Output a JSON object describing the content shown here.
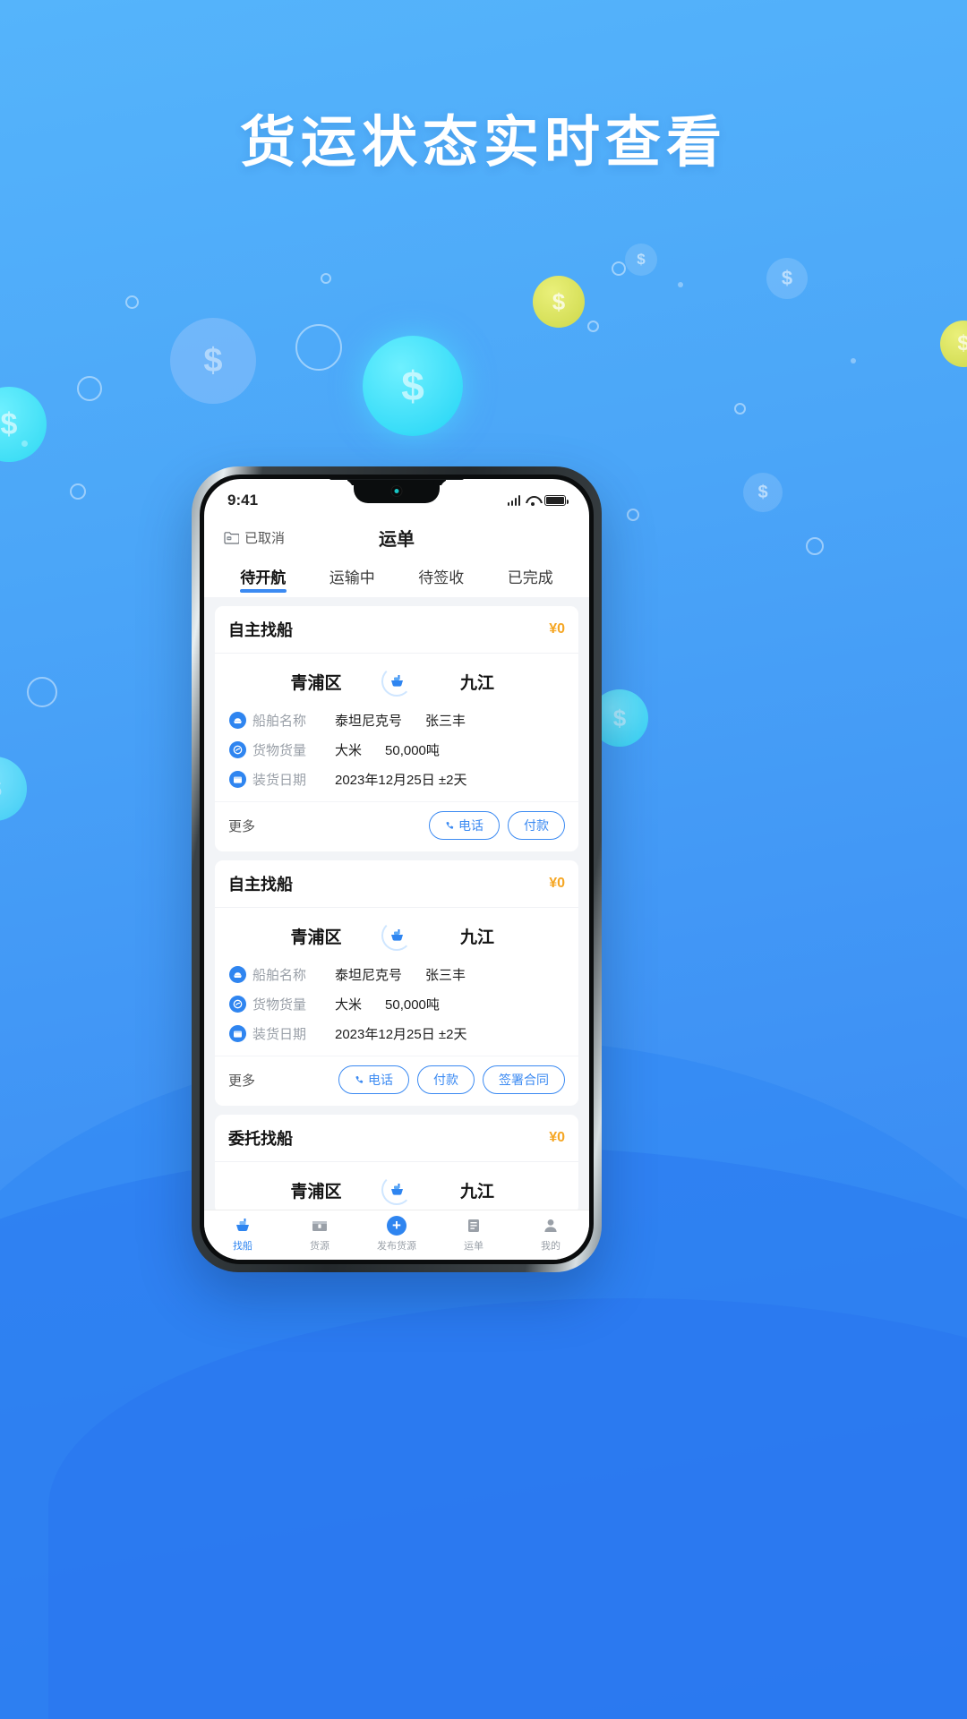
{
  "headline": "货运状态实时查看",
  "colors": {
    "brand_blue": "#3b8af2",
    "bg_top": "#55b4fb",
    "bg_bottom": "#2f7df2",
    "price_orange": "#f5a623",
    "muted": "#9aa0a8"
  },
  "phone": {
    "status_bar": {
      "time": "9:41",
      "signal_icon": "cellular-signal-icon",
      "wifi_icon": "wifi-icon",
      "battery_icon": "battery-icon"
    },
    "navbar": {
      "left_icon": "folder-cancel-icon",
      "left_label": "已取消",
      "title": "运单"
    },
    "tabs": [
      {
        "label": "待开航",
        "active": true
      },
      {
        "label": "运输中",
        "active": false
      },
      {
        "label": "待签收",
        "active": false
      },
      {
        "label": "已完成",
        "active": false
      }
    ],
    "cards": [
      {
        "type": "自主找船",
        "price": "¥0",
        "origin": "青浦区",
        "destination": "九江",
        "route_icon": "ship-icon",
        "rows": [
          {
            "icon": "ship-name-icon",
            "label": "船舶名称",
            "value1": "泰坦尼克号",
            "value2": "张三丰"
          },
          {
            "icon": "cargo-volume-icon",
            "label": "货物货量",
            "value1": "大米",
            "value2": "50,000吨"
          },
          {
            "icon": "loading-date-icon",
            "label": "装货日期",
            "value1": "2023年12月25日 ±2天",
            "value2": ""
          }
        ],
        "more_label": "更多",
        "buttons": [
          {
            "label": "电话",
            "icon": "phone-icon"
          },
          {
            "label": "付款",
            "icon": ""
          }
        ]
      },
      {
        "type": "自主找船",
        "price": "¥0",
        "origin": "青浦区",
        "destination": "九江",
        "route_icon": "ship-icon",
        "rows": [
          {
            "icon": "ship-name-icon",
            "label": "船舶名称",
            "value1": "泰坦尼克号",
            "value2": "张三丰"
          },
          {
            "icon": "cargo-volume-icon",
            "label": "货物货量",
            "value1": "大米",
            "value2": "50,000吨"
          },
          {
            "icon": "loading-date-icon",
            "label": "装货日期",
            "value1": "2023年12月25日 ±2天",
            "value2": ""
          }
        ],
        "more_label": "更多",
        "buttons": [
          {
            "label": "电话",
            "icon": "phone-icon"
          },
          {
            "label": "付款",
            "icon": ""
          },
          {
            "label": "签署合同",
            "icon": ""
          }
        ]
      },
      {
        "type": "委托找船",
        "price": "¥0",
        "origin": "青浦区",
        "destination": "九江",
        "route_icon": "ship-icon",
        "rows": [],
        "more_label": "",
        "buttons": []
      }
    ],
    "bottom_nav": [
      {
        "label": "找船",
        "icon": "ship-nav-icon",
        "active": true
      },
      {
        "label": "货源",
        "icon": "cargo-nav-icon",
        "active": false
      },
      {
        "label": "发布货源",
        "icon": "plus-nav-icon",
        "active": false
      },
      {
        "label": "运单",
        "icon": "waybill-nav-icon",
        "active": false
      },
      {
        "label": "我的",
        "icon": "profile-nav-icon",
        "active": false
      }
    ]
  }
}
